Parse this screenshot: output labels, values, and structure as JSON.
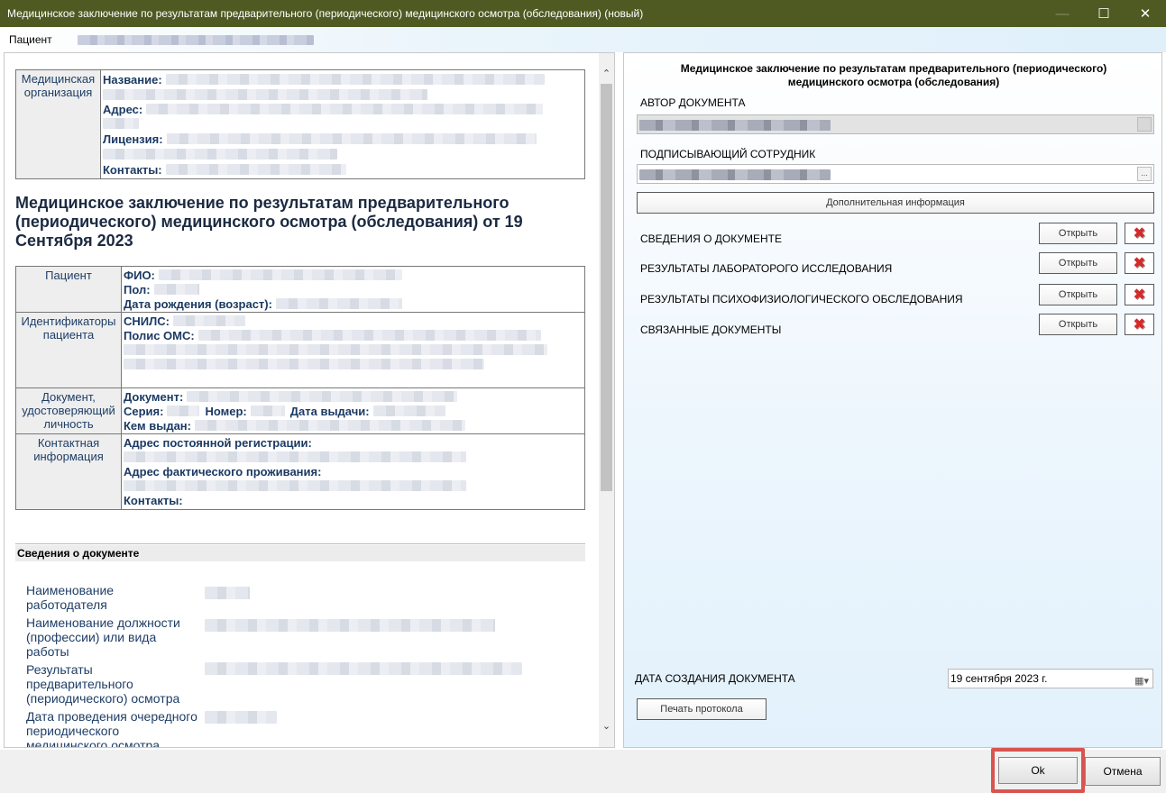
{
  "window": {
    "title": "Медицинское заключение по результатам предварительного (периодического) медицинского осмотра (обследования) (новый)",
    "minimize_glyph": "—",
    "maximize_glyph": "☐",
    "close_glyph": "✕"
  },
  "patient_strip": {
    "label": "Пациент"
  },
  "document": {
    "org": {
      "header": "Медицинская организация",
      "name_label": "Название:",
      "address_label": "Адрес:",
      "license_label": "Лицензия:",
      "contacts_label": "Контакты:"
    },
    "title": "Медицинское заключение по результатам предварительного (периодического) медицинского осмотра (обследования) от 19 Сентября 2023",
    "patient_table": {
      "patient_header": "Пациент",
      "fio_label": "ФИО:",
      "sex_label": "Пол:",
      "dob_label": "Дата рождения (возраст):",
      "ids_header": "Идентификаторы пациента",
      "snils_label": "СНИЛС:",
      "oms_label": "Полис ОМС:",
      "iddoc_header": "Документ, удостоверяющий личность",
      "doc_label": "Документ:",
      "series_label": "Серия:",
      "number_label": "Номер:",
      "issue_date_label": "Дата выдачи:",
      "issued_by_label": "Кем выдан:",
      "contact_header": "Контактная информация",
      "perm_addr_label": "Адрес постоянной регистрации:",
      "fact_addr_label": "Адрес фактического проживания:",
      "contacts_label": "Контакты:"
    },
    "section_title": "Сведения о документе",
    "fields": [
      "Наименование работодателя",
      "Наименование должности (профессии) или вида работы",
      "Результаты предварительного (периодического) осмотра",
      "Дата проведения очередного периодического медицинского осмотра"
    ]
  },
  "right_panel": {
    "title": "Медицинское заключение по результатам предварительного (периодического) медицинского осмотра (обследования)",
    "author_label": "АВТОР ДОКУМЕНТА",
    "signer_label": "ПОДПИСЫВАЮЩИЙ СОТРУДНИК",
    "ellipsis_glyph": "...",
    "additional_info_button": "Дополнительная информация",
    "sections": [
      {
        "label": "СВЕДЕНИЯ О ДОКУМЕНТЕ",
        "open_button": "Открыть"
      },
      {
        "label": "РЕЗУЛЬТАТЫ ЛАБОРАТОРОГО ИССЛЕДОВАНИЯ",
        "open_button": "Открыть"
      },
      {
        "label": "РЕЗУЛЬТАТЫ ПСИХОФИЗИОЛОГИЧЕСКОГО ОБСЛЕДОВАНИЯ",
        "open_button": "Открыть"
      },
      {
        "label": "СВЯЗАННЫЕ ДОКУМЕНТЫ",
        "open_button": "Открыть"
      }
    ],
    "delete_glyph": "✖",
    "creation_date_label": "ДАТА СОЗДАНИЯ ДОКУМЕНТА",
    "creation_date_value": "19 сентября 2023 г.",
    "calendar_glyph": "▦▾",
    "print_button": "Печать протокола"
  },
  "scrollbar": {
    "up_glyph": "⌃",
    "down_glyph": "⌄"
  },
  "footer": {
    "ok_button": "Ok",
    "cancel_button": "Отмена"
  },
  "colors": {
    "titlebar": "#4f5a22",
    "highlight": "#d9534f",
    "label_blue": "#1f3e66"
  }
}
